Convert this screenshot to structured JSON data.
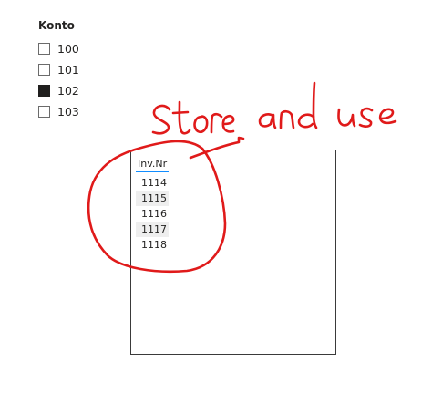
{
  "slicer": {
    "title": "Konto",
    "items": [
      {
        "label": "100",
        "checked": false
      },
      {
        "label": "101",
        "checked": false
      },
      {
        "label": "102",
        "checked": true
      },
      {
        "label": "103",
        "checked": false
      }
    ]
  },
  "table": {
    "header": "Inv.Nr",
    "rows": [
      "1114",
      "1115",
      "1116",
      "1117",
      "1118"
    ]
  },
  "annotation": {
    "text": "Store and use",
    "color": "#e01a1a"
  },
  "colors": {
    "header_underline": "#118dff",
    "row_alt_background": "#eeeeee",
    "checkbox_checked": "#201f1e"
  }
}
